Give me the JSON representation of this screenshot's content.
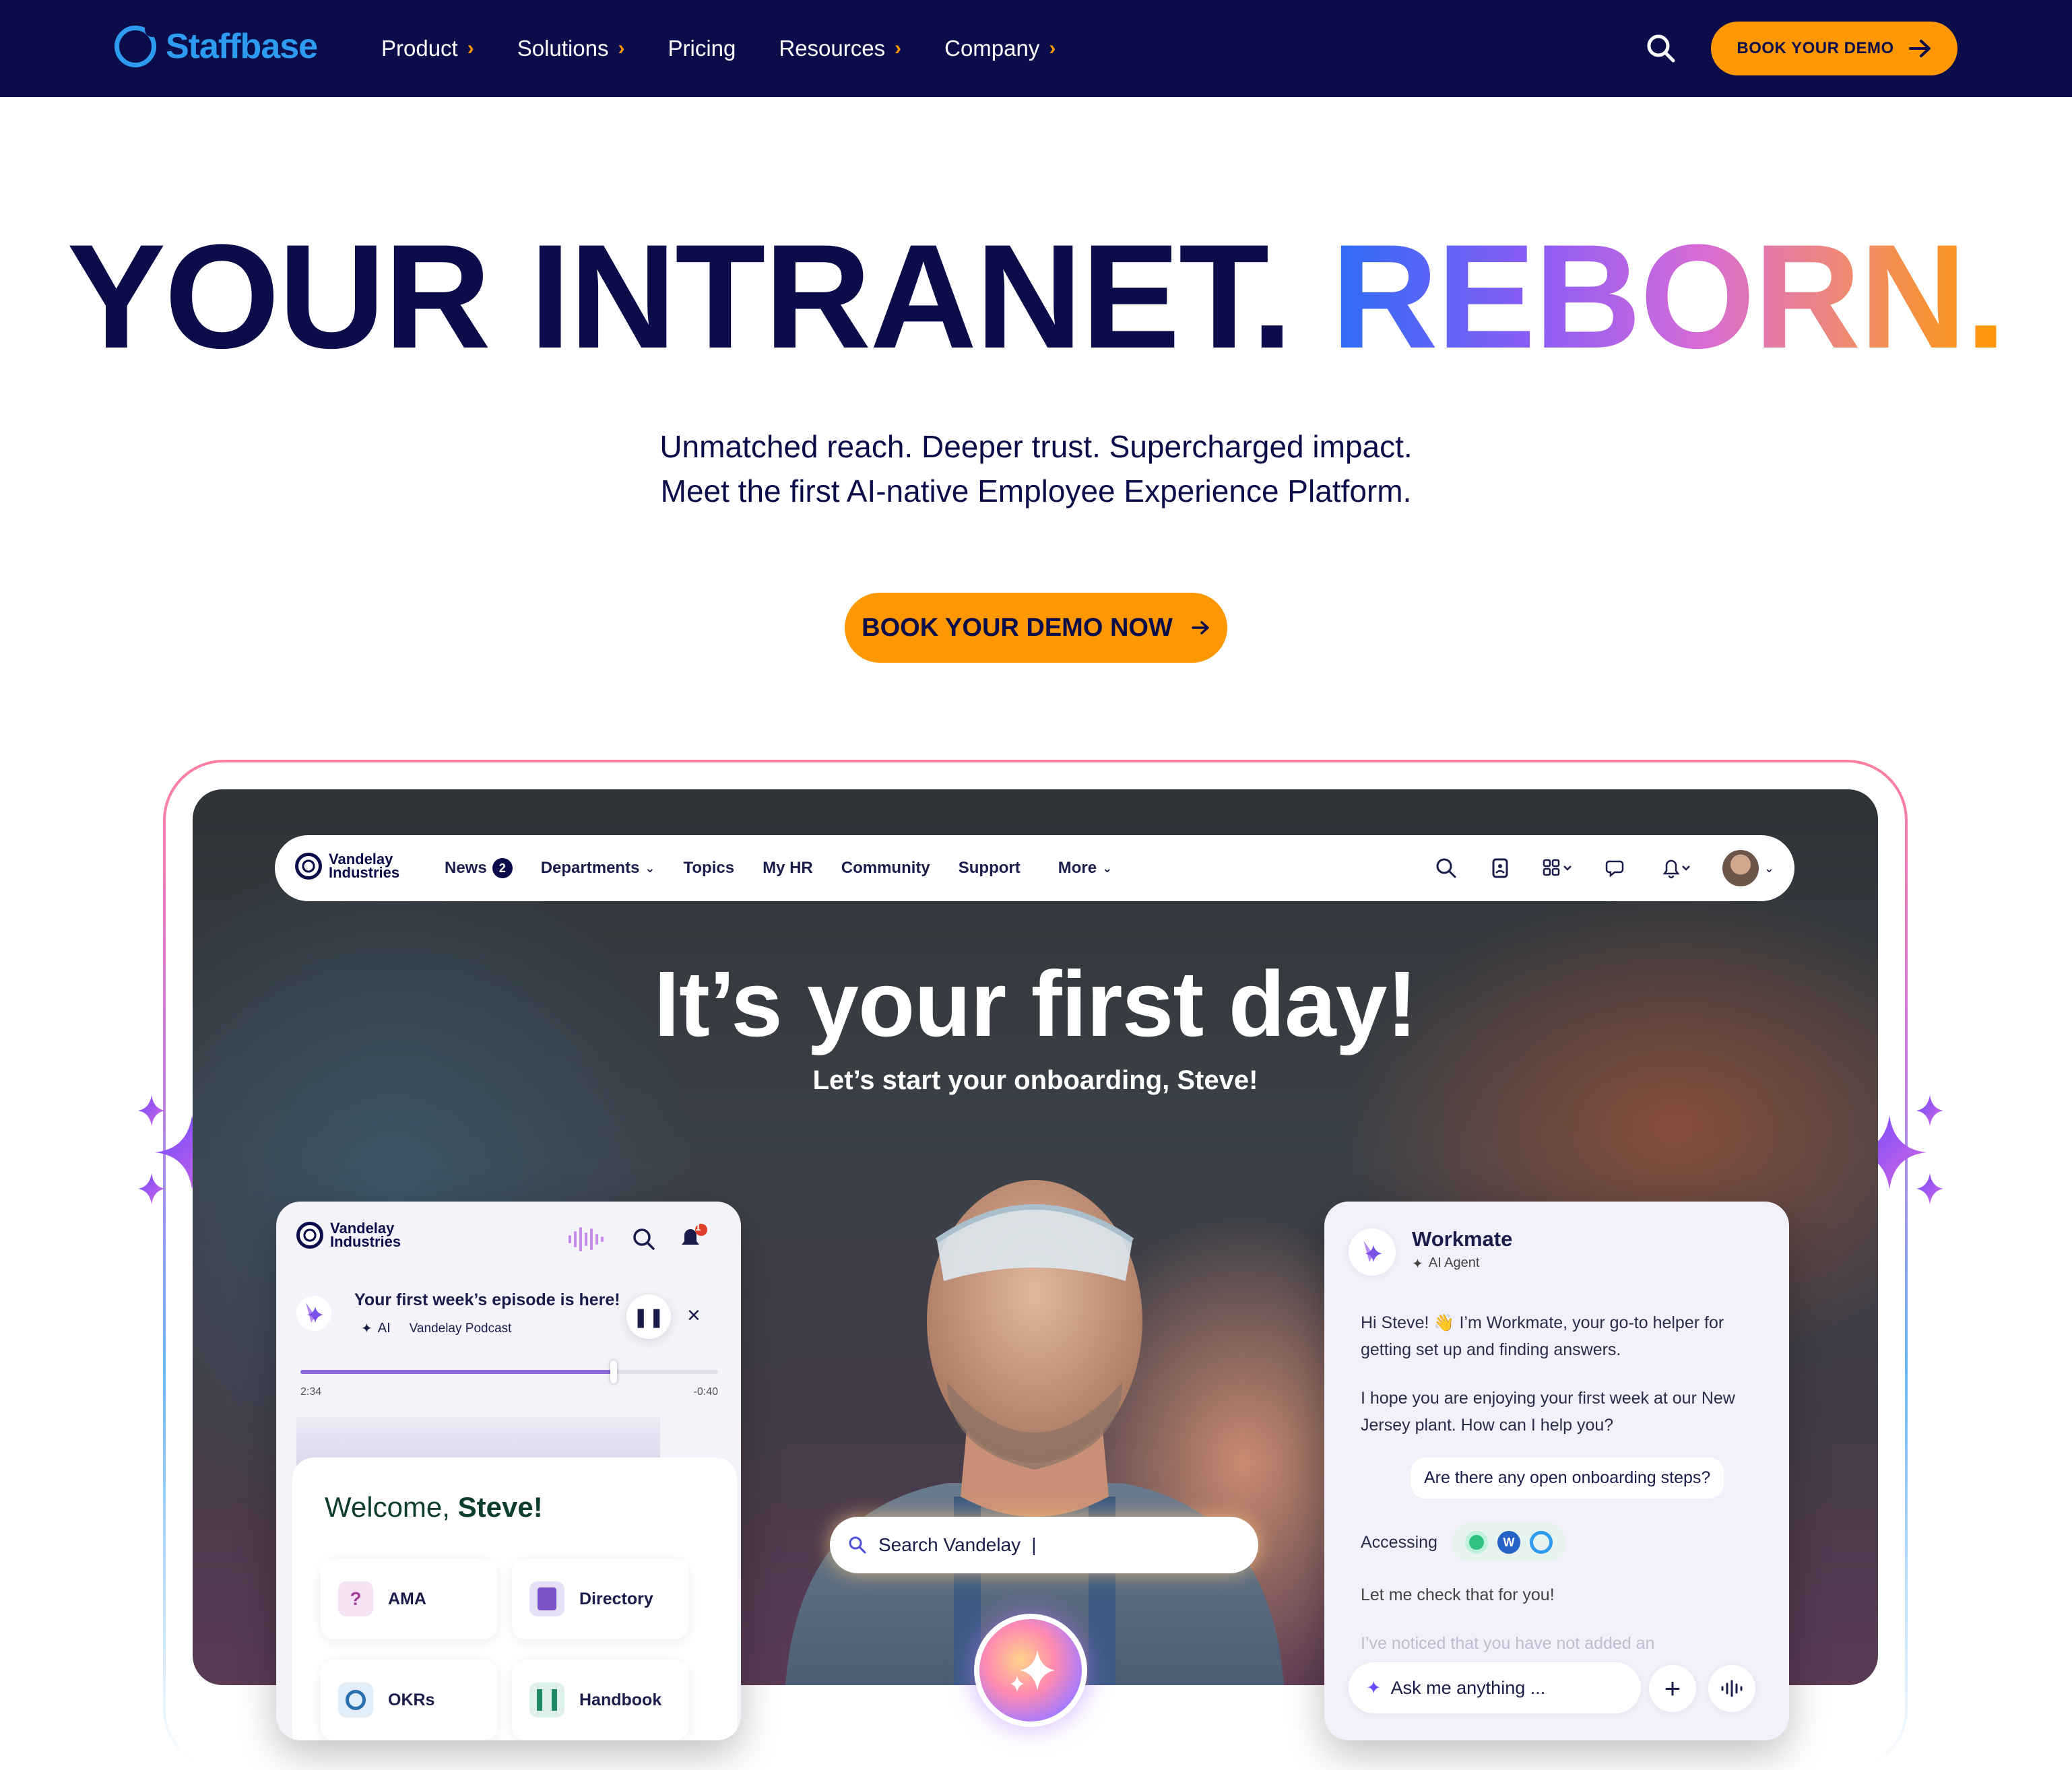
{
  "brand": {
    "name": "Staffbase"
  },
  "nav": {
    "items": [
      {
        "label": "Product",
        "chevron": true
      },
      {
        "label": "Solutions",
        "chevron": true
      },
      {
        "label": "Pricing",
        "chevron": false
      },
      {
        "label": "Resources",
        "chevron": true
      },
      {
        "label": "Company",
        "chevron": true
      }
    ],
    "cta": "BOOK YOUR DEMO"
  },
  "hero": {
    "title_main": "YOUR INTRANET.",
    "title_accent": "REBORN.",
    "subtitle_line1": "Unmatched reach. Deeper trust. Supercharged impact.",
    "subtitle_line2": "Meet the first AI-native Employee Experience Platform.",
    "cta": "BOOK YOUR DEMO NOW"
  },
  "colors": {
    "navy": "#0b0d4a",
    "orange": "#ff9800",
    "blue": "#2d9cf0"
  },
  "mock": {
    "company_line1": "Vandelay",
    "company_line2": "Industries",
    "nav_items": [
      {
        "label": "News",
        "badge": "2"
      },
      {
        "label": "Departments",
        "chevron": true
      },
      {
        "label": "Topics"
      },
      {
        "label": "My HR"
      },
      {
        "label": "Community"
      },
      {
        "label": "Support"
      },
      {
        "label": "More",
        "chevron": true
      }
    ],
    "headline": "It’s your first day!",
    "subline": "Let’s start your onboarding, Steve!",
    "search_text": "Search Vandelay",
    "left_card": {
      "notif_count": "1",
      "podcast_title": "Your first week’s episode is here!",
      "podcast_tag": "AI",
      "podcast_source": "Vandelay Podcast",
      "time_elapsed": "2:34",
      "time_remaining": "-0:40",
      "progress": 0.75,
      "welcome_prefix": "Welcome, ",
      "welcome_name": "Steve!",
      "tiles": [
        "AMA",
        "Directory",
        "OKRs",
        "Handbook"
      ]
    },
    "right_card": {
      "agent_name": "Workmate",
      "agent_role": "AI Agent",
      "msg1": "Hi Steve! 👋 I’m Workmate, your go-to helper for getting set up and finding answers.",
      "msg2": "I hope you are enjoying your first week at our New Jersey plant. How can I help you?",
      "user_msg": "Are there any open onboarding steps?",
      "accessing_label": "Accessing",
      "check_msg": "Let me check that for you!",
      "faded_msg": "I’ve noticed that you have not added an",
      "ask_placeholder": "Ask me anything ..."
    }
  }
}
